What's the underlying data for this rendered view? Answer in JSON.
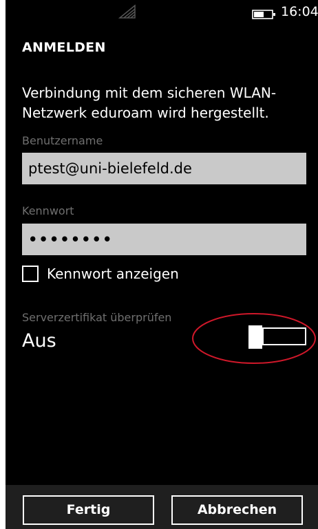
{
  "status_bar": {
    "time": "16:04",
    "signal_icon": "wifi-signal-icon",
    "battery_icon": "battery-icon"
  },
  "page": {
    "title": "ANMELDEN",
    "info_text": "Verbindung mit dem sicheren WLAN-Netzwerk eduroam wird hergestellt."
  },
  "form": {
    "username_label": "Benutzername",
    "username_value": "ptest@uni-bielefeld.de",
    "password_label": "Kennwort",
    "password_value": "••••••••",
    "show_password_label": "Kennwort anzeigen",
    "show_password_checked": false,
    "cert_label": "Serverzertifikat überprüfen",
    "cert_state": "Aus",
    "cert_toggle_on": false
  },
  "app_bar": {
    "done_label": "Fertig",
    "cancel_label": "Abbrechen"
  },
  "colors": {
    "background": "#000000",
    "textbox": "#c9c9c9",
    "label": "#6f6f6f",
    "annotation": "#d0182a",
    "appbar": "#1f1f1f"
  }
}
